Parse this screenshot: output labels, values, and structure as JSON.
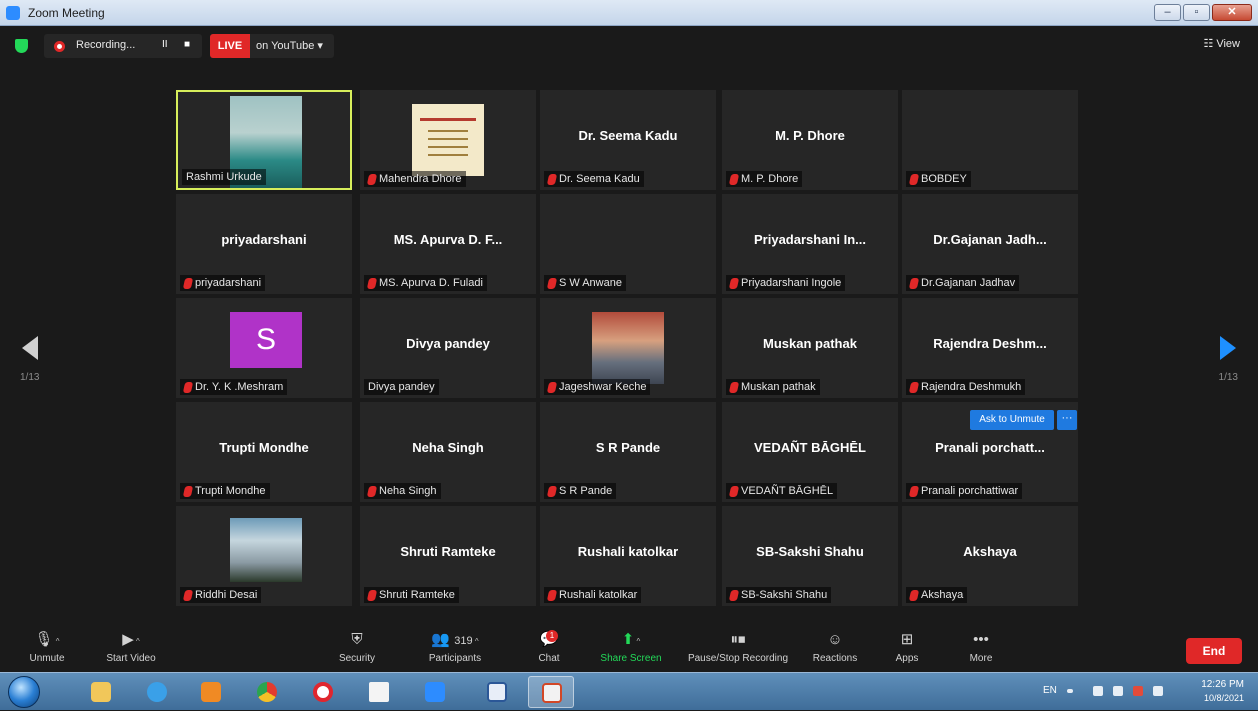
{
  "window": {
    "title": "Zoom Meeting",
    "controls": {
      "minimize": "–",
      "maximize": "▫",
      "close": "✕"
    }
  },
  "topbar": {
    "recording": {
      "label": "Recording...",
      "pause": "II",
      "stop": "■"
    },
    "live": {
      "badge": "LIVE",
      "label": "on YouTube ▾"
    },
    "view": "☷ View"
  },
  "pager": {
    "left": "1/13",
    "right": "1/13"
  },
  "participants": [
    {
      "id": "t1",
      "display": "",
      "label": "Rashmi Urkude",
      "muted": false
    },
    {
      "id": "t2",
      "display": "",
      "label": "Mahendra Dhore",
      "muted": true
    },
    {
      "id": "t3",
      "display": "Dr. Seema Kadu",
      "label": "Dr. Seema Kadu",
      "muted": true
    },
    {
      "id": "t4",
      "display": "M. P. Dhore",
      "label": "M. P. Dhore",
      "muted": true
    },
    {
      "id": "t5",
      "display": "",
      "label": "BOBDEY",
      "muted": true
    },
    {
      "id": "t6",
      "display": "priyadarshani",
      "label": "priyadarshani",
      "muted": true
    },
    {
      "id": "t7",
      "display": "MS. Apurva D. F...",
      "label": "MS. Apurva D. Fuladi",
      "muted": true
    },
    {
      "id": "t8",
      "display": "",
      "label": "S W Anwane",
      "muted": true
    },
    {
      "id": "t9",
      "display": "Priyadarshani In...",
      "label": "Priyadarshani Ingole",
      "muted": true
    },
    {
      "id": "t10",
      "display": "Dr.Gajanan Jadh...",
      "label": "Dr.Gajanan Jadhav",
      "muted": true
    },
    {
      "id": "t11",
      "display": "",
      "avatar_letter": "S",
      "label": "Dr. Y. K .Meshram",
      "muted": true
    },
    {
      "id": "t12",
      "display": "Divya pandey",
      "label": "Divya pandey",
      "muted": false
    },
    {
      "id": "t13",
      "display": "",
      "label": "Jageshwar Keche",
      "muted": true
    },
    {
      "id": "t14",
      "display": "Muskan pathak",
      "label": "Muskan pathak",
      "muted": true
    },
    {
      "id": "t15",
      "display": "Rajendra Deshm...",
      "label": "Rajendra Deshmukh",
      "muted": true
    },
    {
      "id": "t16",
      "display": "Trupti Mondhe",
      "label": "Trupti Mondhe",
      "muted": true
    },
    {
      "id": "t17",
      "display": "Neha Singh",
      "label": "Neha Singh",
      "muted": true
    },
    {
      "id": "t18",
      "display": "S R Pande",
      "label": "S R Pande",
      "muted": true
    },
    {
      "id": "t19",
      "display": "VEDAÑT BĀGHĒL",
      "label": "VEDAÑT BĀGHĒL",
      "muted": true
    },
    {
      "id": "t20",
      "display": "Pranali porchatt...",
      "label": "Pranali porchattiwar",
      "muted": true
    },
    {
      "id": "t21",
      "display": "",
      "label": "Riddhi Desai",
      "muted": true
    },
    {
      "id": "t22",
      "display": "Shruti Ramteke",
      "label": "Shruti Ramteke",
      "muted": true
    },
    {
      "id": "t23",
      "display": "Rushali katolkar",
      "label": "Rushali katolkar",
      "muted": true
    },
    {
      "id": "t24",
      "display": "SB-Sakshi Shahu",
      "label": "SB-Sakshi Shahu",
      "muted": true
    },
    {
      "id": "t25",
      "display": "Akshaya",
      "label": "Akshaya",
      "muted": true
    }
  ],
  "hover": {
    "ask_unmute": "Ask to Unmute",
    "more": "···"
  },
  "toolbar": {
    "unmute": "Unmute",
    "start_video": "Start Video",
    "security": "Security",
    "participants": "Participants",
    "participants_count": "319",
    "chat": "Chat",
    "chat_badge": "1",
    "share_screen": "Share Screen",
    "pause_stop_recording": "Pause/Stop Recording",
    "reactions": "Reactions",
    "apps": "Apps",
    "more": "More",
    "end": "End"
  },
  "taskbar": {
    "language": "EN",
    "time": "12:26 PM",
    "date": "10/8/2021"
  },
  "colors": {
    "accent": "#2D8CFF",
    "active_speaker": "#D7EE5B",
    "end": "#E02828",
    "share": "#23D959"
  }
}
